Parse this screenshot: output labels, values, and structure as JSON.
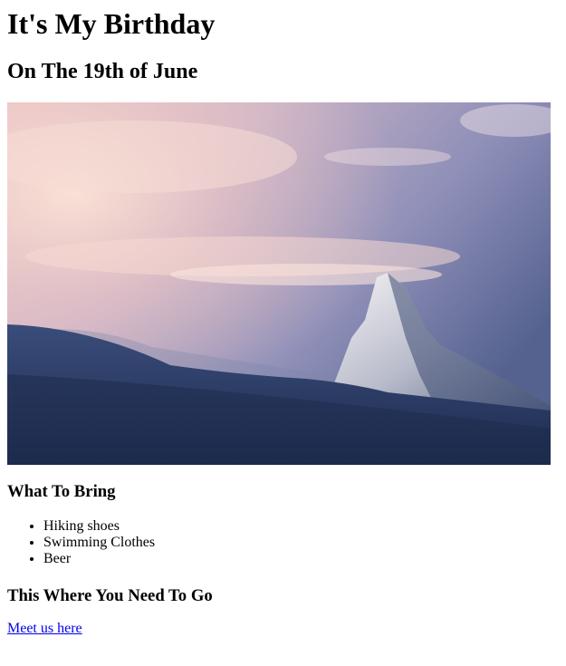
{
  "page": {
    "title": "It's My Birthday",
    "subtitle": "On The 19th of June"
  },
  "hero": {
    "icon": "mountain-photo"
  },
  "bring": {
    "heading": "What To Bring",
    "items": [
      {
        "label": "Hiking shoes"
      },
      {
        "label": "Swimming Clothes"
      },
      {
        "label": "Beer"
      }
    ]
  },
  "location": {
    "heading": "This Where You Need To Go",
    "link_text": "Meet us here"
  },
  "colors": {
    "link": "#0000ee",
    "sky_top": "#6b72a0",
    "sky_glow": "#f3c6c0",
    "snow_shadow": "#27385f"
  }
}
